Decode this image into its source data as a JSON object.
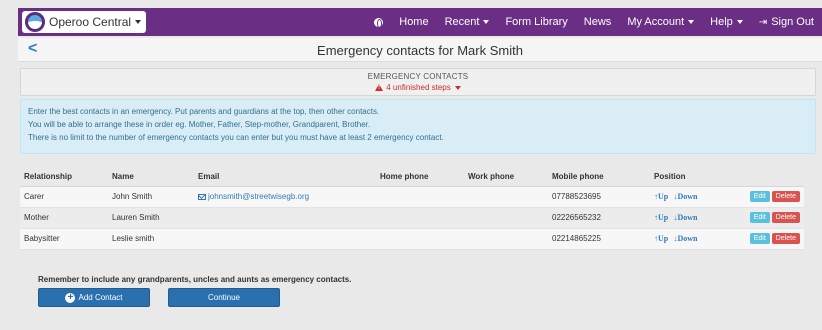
{
  "navbar": {
    "brand": "Operoo Central",
    "items": [
      "Home",
      "Recent",
      "Form Library",
      "News",
      "My Account",
      "Help",
      "Sign Out"
    ]
  },
  "header": {
    "title": "Emergency contacts for Mark Smith"
  },
  "steps": {
    "title": "EMERGENCY CONTACTS",
    "status": "4 unfinished steps"
  },
  "info": {
    "lines": [
      "Enter the best contacts in an emergency. Put parents and guardians at the top, then other contacts.",
      "You will be able to arrange these in order eg. Mother, Father, Step-mother, Grandparent, Brother.",
      "There is no limit to the number of emergency contacts you can enter but you must have at least 2 emergency contact."
    ]
  },
  "table": {
    "columns": [
      "Relationship",
      "Name",
      "Email",
      "Home phone",
      "Work phone",
      "Mobile phone",
      "Position"
    ],
    "rows": [
      {
        "relationship": "Carer",
        "name": "John Smith",
        "email": "johnsmith@streetwisegb.org",
        "home": "",
        "work": "",
        "mobile": "07788523695"
      },
      {
        "relationship": "Mother",
        "name": "Lauren Smith",
        "email": "",
        "home": "",
        "work": "",
        "mobile": "02226565232"
      },
      {
        "relationship": "Babysitter",
        "name": "Leslie smith",
        "email": "",
        "home": "",
        "work": "",
        "mobile": "02214865225"
      }
    ],
    "position_up": "↑Up",
    "position_down": "↓Down",
    "edit_label": "Edit",
    "delete_label": "Delete"
  },
  "footer": {
    "reminder": "Remember to include any grandparents, uncles and aunts as emergency contacts.",
    "add_label": "Add Contact",
    "continue_label": "Continue"
  }
}
